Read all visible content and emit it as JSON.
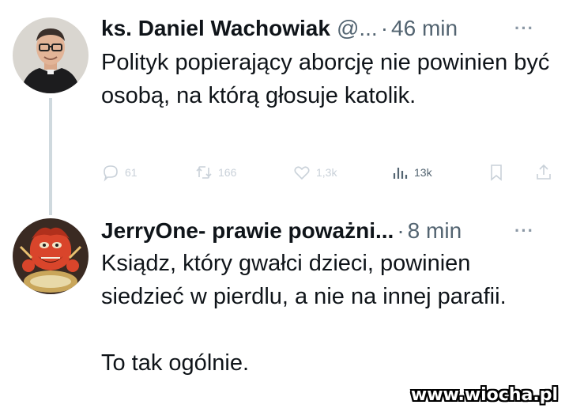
{
  "tweets": [
    {
      "author_name": "ks. Daniel Wachowiak",
      "handle": "@...",
      "separator": "·",
      "time": "46 min",
      "more": "···",
      "text": "Polityk popierający aborcję nie powinien być osobą, na którą głosuje katolik.",
      "actions": {
        "replies": "61",
        "reposts": "166",
        "likes": "1,3k",
        "views": "13k"
      },
      "icons": [
        "reply-icon",
        "repost-icon",
        "like-icon",
        "views-icon",
        "bookmark-icon",
        "share-icon"
      ]
    },
    {
      "author_name": "JerryOne- prawie poważni...",
      "separator": "·",
      "time": "8 min",
      "more": "···",
      "paragraphs": [
        "Ksiądz, który gwałci dzieci, powinien siedzieć w pierdlu, a nie na innej parafii.",
        "To tak ogólnie."
      ]
    }
  ],
  "watermark": "www.wiocha.pl",
  "colors": {
    "text": "#0f1419",
    "secondary": "#536471",
    "thread_line": "#cfd9de",
    "faded_icons": "#c9d1d9"
  }
}
